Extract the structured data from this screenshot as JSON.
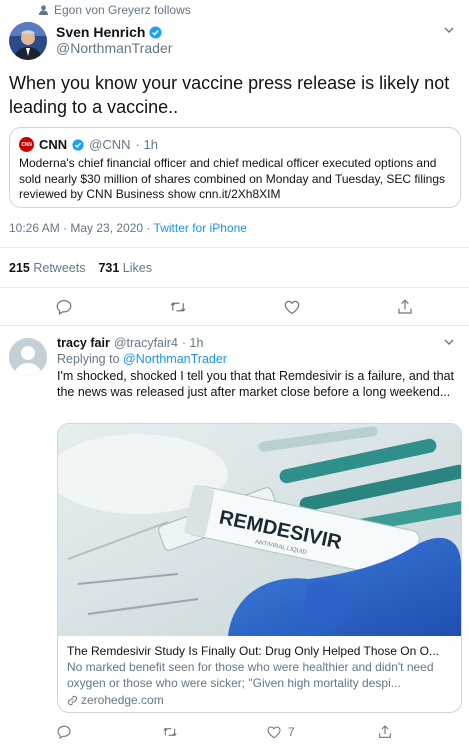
{
  "social_context": "Egon von Greyerz follows",
  "tweet": {
    "author_name": "Sven Henrich",
    "author_handle": "@NorthmanTrader",
    "text": "When you know your vaccine press release is likely not leading to a vaccine..",
    "quote": {
      "author_name": "CNN",
      "logo_text": "CNN",
      "author_handle": "@CNN",
      "time": "· 1h",
      "text": "Moderna's chief financial officer and chief medical officer executed options and sold nearly $30 million of shares combined on Monday and Tuesday, SEC filings reviewed by CNN Business show cnn.it/2Xh8XIM"
    },
    "timestamp": "10:26 AM · May 23, 2020 ·",
    "source": "Twitter for iPhone",
    "retweets_count": "215",
    "retweets_label": "Retweets",
    "likes_count": "731",
    "likes_label": "Likes"
  },
  "reply": {
    "author_name": "tracy fair",
    "author_handle": "@tracyfair4",
    "time": "· 1h",
    "replying_label": "Replying to",
    "replying_to": "@NorthmanTrader",
    "text": "I'm shocked, shocked I tell you that that  Remdesivir is a failure, and that the news was released just after market close before a long weekend...",
    "card": {
      "image_label": "REMDESIVIR",
      "image_sublabel": "ANTIVIRAL LIQUID",
      "title": "The Remdesivir Study Is Finally Out: Drug Only Helped Those On O...",
      "description": "No marked benefit seen for those who were healthier and didn't need oxygen or those who were sicker; \"Given high mortality despi...",
      "domain": "zerohedge.com"
    },
    "retweet_count": "7"
  },
  "icons": {
    "social_context": "person-icon",
    "verified": "verified-badge-icon",
    "caret": "chevron-down-icon",
    "reply": "comment-icon",
    "retweet": "retweet-icon",
    "like": "heart-icon",
    "share": "share-icon",
    "link": "link-icon"
  },
  "colors": {
    "accent": "#1b95e0",
    "muted": "#657786",
    "cnn_red": "#cc0000"
  }
}
